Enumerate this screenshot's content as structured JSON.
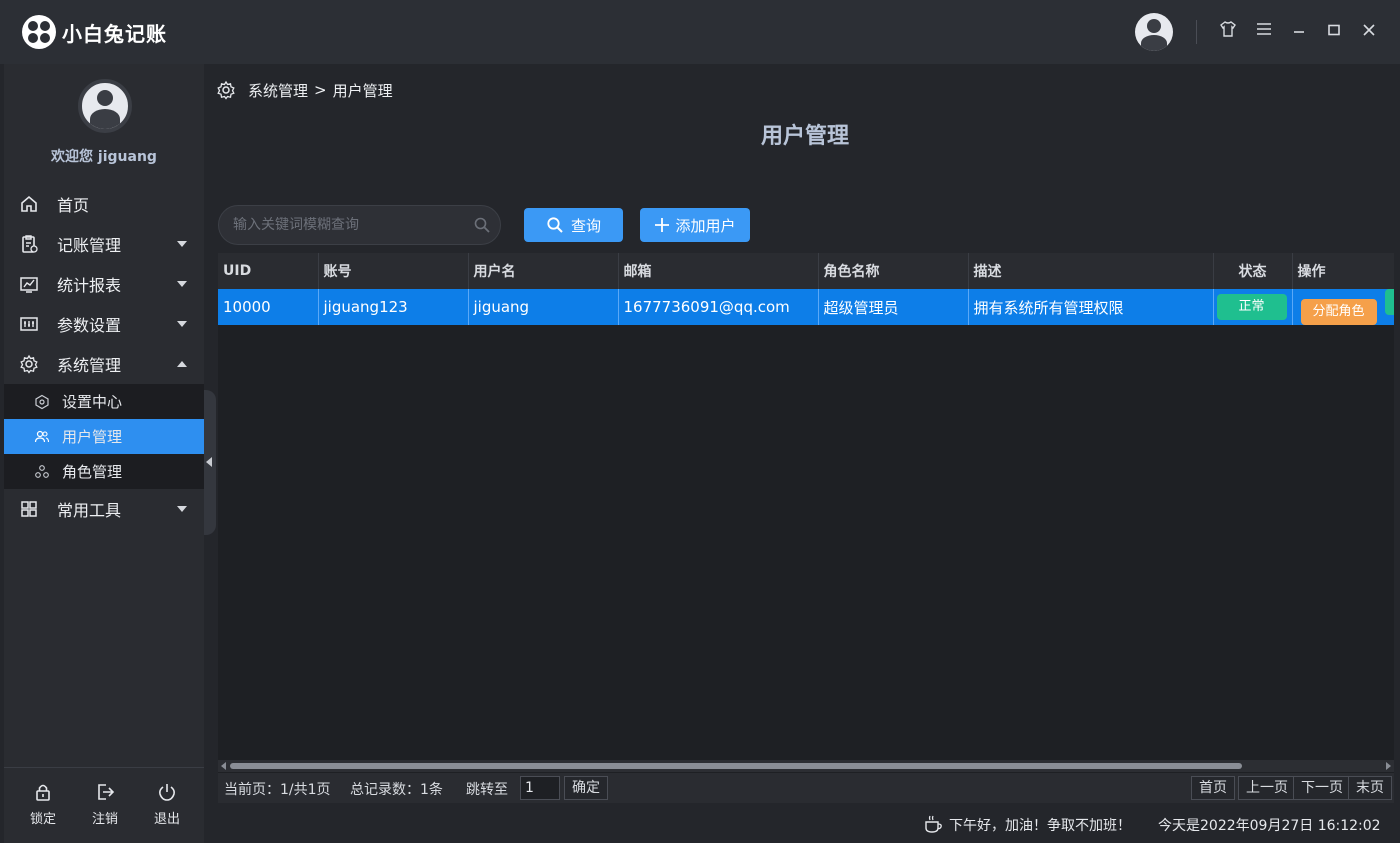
{
  "app": {
    "title": "小白兔记账"
  },
  "titlebar": {
    "skin_icon": "shirt-icon",
    "menu_icon": "hamburger-icon",
    "minimize": "—",
    "maximize": "□",
    "close": "✕"
  },
  "sidebar": {
    "welcome": "欢迎您 jiguang",
    "nav": [
      {
        "label": "首页",
        "icon": "home-icon"
      },
      {
        "label": "记账管理",
        "icon": "clipboard-icon"
      },
      {
        "label": "统计报表",
        "icon": "chart-icon"
      },
      {
        "label": "参数设置",
        "icon": "sliders-icon"
      },
      {
        "label": "系统管理",
        "icon": "gear-icon"
      },
      {
        "label": "常用工具",
        "icon": "grid-icon"
      }
    ],
    "sub_items": [
      {
        "label": "设置中心",
        "icon": "hexagon-icon"
      },
      {
        "label": "用户管理",
        "icon": "users-icon"
      },
      {
        "label": "角色管理",
        "icon": "roles-icon"
      }
    ],
    "bottom": [
      {
        "label": "锁定",
        "icon": "lock-icon"
      },
      {
        "label": "注销",
        "icon": "logout-icon"
      },
      {
        "label": "退出",
        "icon": "power-icon"
      }
    ]
  },
  "breadcrumb": {
    "parent": "系统管理",
    "separator": ">",
    "current": "用户管理"
  },
  "page": {
    "title": "用户管理"
  },
  "toolbar": {
    "search_placeholder": "输入关键词模糊查询",
    "query_label": "查询",
    "add_label": "添加用户"
  },
  "table": {
    "columns": [
      "UID",
      "账号",
      "用户名",
      "邮箱",
      "角色名称",
      "描述",
      "状态",
      "操作"
    ],
    "rows": [
      {
        "uid": "10000",
        "account": "jiguang123",
        "username": "jiguang",
        "email": "1677736091@qq.com",
        "role": "超级管理员",
        "description": "拥有系统所有管理权限",
        "status": "正常",
        "action": "分配角色"
      }
    ]
  },
  "pager": {
    "current_page": "当前页：1/共1页",
    "total": "总记录数：1条",
    "jump_label": "跳转至",
    "jump_value": "1",
    "confirm": "确定",
    "first": "首页",
    "prev": "上一页",
    "next": "下一页",
    "last": "末页"
  },
  "status": {
    "greeting": "下午好，加油！争取不加班！",
    "date": "今天是2022年09月27日 16:12:02"
  },
  "colors": {
    "accent": "#2e8ff0",
    "selected_row": "#0d7ee8",
    "status_green": "#1fbf8f",
    "action_orange": "#f5a04a"
  }
}
